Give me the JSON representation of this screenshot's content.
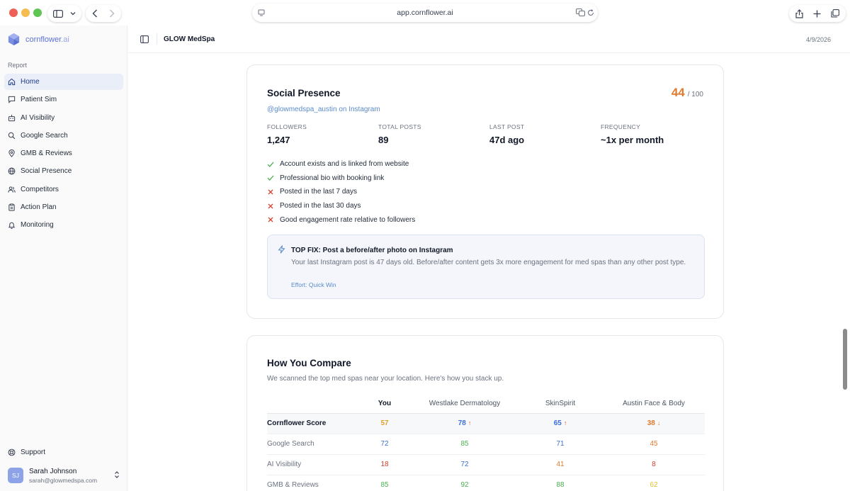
{
  "browser": {
    "url": "app.cornflower.ai",
    "colors": {
      "close": "#ee5f57",
      "minimize": "#f5bd4f",
      "zoom": "#5fc553"
    }
  },
  "sidebar": {
    "brand": {
      "name": "cornflower",
      "tld": ".ai"
    },
    "section_label": "Report",
    "items": [
      {
        "label": "Home",
        "icon": "home-icon",
        "active": true
      },
      {
        "label": "Patient Sim",
        "icon": "chat-icon"
      },
      {
        "label": "AI Visibility",
        "icon": "robot-icon"
      },
      {
        "label": "Google Search",
        "icon": "search-icon"
      },
      {
        "label": "GMB & Reviews",
        "icon": "map-pin-icon"
      },
      {
        "label": "Social Presence",
        "icon": "globe-icon"
      },
      {
        "label": "Competitors",
        "icon": "users-icon"
      },
      {
        "label": "Action Plan",
        "icon": "clipboard-icon"
      },
      {
        "label": "Monitoring",
        "icon": "bell-icon"
      }
    ],
    "support_label": "Support",
    "user": {
      "initials": "SJ",
      "name": "Sarah Johnson",
      "email": "sarah@glowmedspa.com"
    }
  },
  "header": {
    "title": "GLOW MedSpa",
    "date": "4/9/2026"
  },
  "social": {
    "title": "Social Presence",
    "score": "44",
    "score_max": "/ 100",
    "handle": "@glowmedspa_austin on Instagram",
    "stats": [
      {
        "label": "FOLLOWERS",
        "value": "1,247"
      },
      {
        "label": "TOTAL POSTS",
        "value": "89"
      },
      {
        "label": "LAST POST",
        "value": "47d ago"
      },
      {
        "label": "FREQUENCY",
        "value": "~1x per month"
      }
    ],
    "checks": [
      {
        "text": "Account exists and is linked from website",
        "pass": true
      },
      {
        "text": "Professional bio with booking link",
        "pass": true
      },
      {
        "text": "Posted in the last 7 days",
        "pass": false
      },
      {
        "text": "Posted in the last 30 days",
        "pass": false
      },
      {
        "text": "Good engagement rate relative to followers",
        "pass": false
      }
    ],
    "top_fix": {
      "title": "TOP FIX: Post a before/after photo on Instagram",
      "body": "Your last Instagram post is 47 days old. Before/after content gets 3x more engagement for med spas than any other post type.",
      "effort": "Effort: Quick Win"
    }
  },
  "compare": {
    "title": "How You Compare",
    "subtitle": "We scanned the top med spas near your location. Here's how you stack up.",
    "columns": [
      "You",
      "Westlake Dermatology",
      "SkinSpirit",
      "Austin Face & Body"
    ],
    "rows": [
      {
        "metric": "Cornflower Score",
        "highlight": true,
        "cells": [
          {
            "value": "57",
            "color": "#e0a12e"
          },
          {
            "value": "78",
            "color": "#3b6fd6",
            "arrow": "↑",
            "arrow_color": "#e04a3a"
          },
          {
            "value": "65",
            "color": "#3b6fd6",
            "arrow": "↑",
            "arrow_color": "#e04a3a"
          },
          {
            "value": "38",
            "color": "#e07a2e",
            "arrow": "↓",
            "arrow_color": "#e07a2e"
          }
        ]
      },
      {
        "metric": "Google Search",
        "cells": [
          {
            "value": "72",
            "color": "#3b6fd6"
          },
          {
            "value": "85",
            "color": "#4caf50"
          },
          {
            "value": "71",
            "color": "#3b6fd6"
          },
          {
            "value": "45",
            "color": "#e07a2e"
          }
        ]
      },
      {
        "metric": "AI Visibility",
        "cells": [
          {
            "value": "18",
            "color": "#d93a2b"
          },
          {
            "value": "72",
            "color": "#3b6fd6"
          },
          {
            "value": "41",
            "color": "#e07a2e"
          },
          {
            "value": "8",
            "color": "#d93a2b"
          }
        ]
      },
      {
        "metric": "GMB & Reviews",
        "cells": [
          {
            "value": "85",
            "color": "#4caf50"
          },
          {
            "value": "92",
            "color": "#4caf50"
          },
          {
            "value": "88",
            "color": "#4caf50"
          },
          {
            "value": "62",
            "color": "#e0c22e"
          }
        ]
      }
    ]
  }
}
